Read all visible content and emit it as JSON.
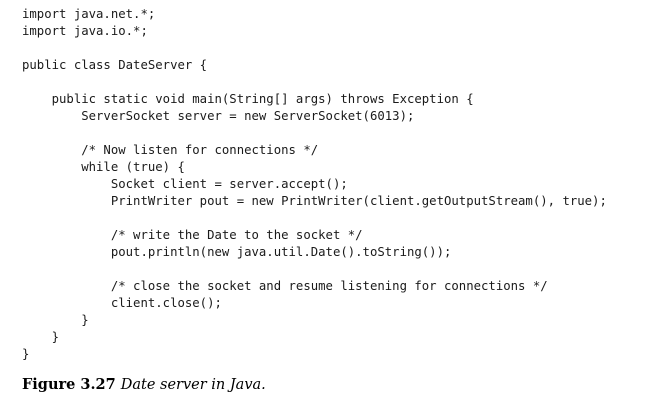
{
  "code_lines": [
    "import java.net.*;",
    "import java.io.*;",
    "",
    "public class DateServer {",
    "",
    "    public static void main(String[] args) throws Exception {",
    "        ServerSocket server = new ServerSocket(6013);",
    "",
    "        /* Now listen for connections */",
    "        while (true) {",
    "            Socket client = server.accept();",
    "            PrintWriter pout = new PrintWriter(client.getOutputStream(), true);",
    "",
    "            /* write the Date to the socket */",
    "            pout.println(new java.util.Date().toString());",
    "",
    "            /* close the socket and resume listening for connections */",
    "            client.close();",
    "        }",
    "    }",
    "}"
  ],
  "caption": {
    "label": "Figure 3.27",
    "text": "Date server in Java."
  }
}
